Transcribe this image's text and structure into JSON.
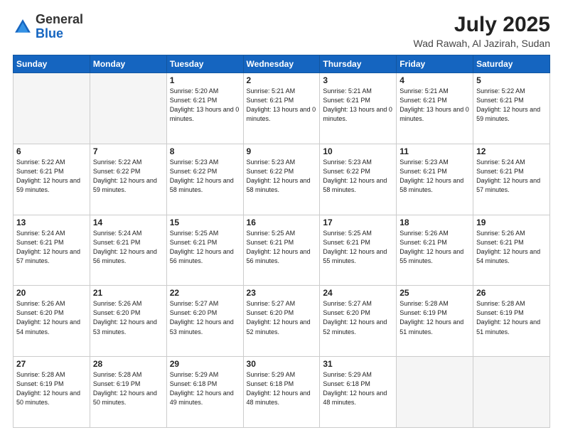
{
  "header": {
    "logo_line1": "General",
    "logo_line2": "Blue",
    "month_title": "July 2025",
    "location": "Wad Rawah, Al Jazirah, Sudan"
  },
  "weekdays": [
    "Sunday",
    "Monday",
    "Tuesday",
    "Wednesday",
    "Thursday",
    "Friday",
    "Saturday"
  ],
  "weeks": [
    [
      {
        "day": "",
        "info": ""
      },
      {
        "day": "",
        "info": ""
      },
      {
        "day": "1",
        "info": "Sunrise: 5:20 AM\nSunset: 6:21 PM\nDaylight: 13 hours and 0 minutes."
      },
      {
        "day": "2",
        "info": "Sunrise: 5:21 AM\nSunset: 6:21 PM\nDaylight: 13 hours and 0 minutes."
      },
      {
        "day": "3",
        "info": "Sunrise: 5:21 AM\nSunset: 6:21 PM\nDaylight: 13 hours and 0 minutes."
      },
      {
        "day": "4",
        "info": "Sunrise: 5:21 AM\nSunset: 6:21 PM\nDaylight: 13 hours and 0 minutes."
      },
      {
        "day": "5",
        "info": "Sunrise: 5:22 AM\nSunset: 6:21 PM\nDaylight: 12 hours and 59 minutes."
      }
    ],
    [
      {
        "day": "6",
        "info": "Sunrise: 5:22 AM\nSunset: 6:21 PM\nDaylight: 12 hours and 59 minutes."
      },
      {
        "day": "7",
        "info": "Sunrise: 5:22 AM\nSunset: 6:22 PM\nDaylight: 12 hours and 59 minutes."
      },
      {
        "day": "8",
        "info": "Sunrise: 5:23 AM\nSunset: 6:22 PM\nDaylight: 12 hours and 58 minutes."
      },
      {
        "day": "9",
        "info": "Sunrise: 5:23 AM\nSunset: 6:22 PM\nDaylight: 12 hours and 58 minutes."
      },
      {
        "day": "10",
        "info": "Sunrise: 5:23 AM\nSunset: 6:22 PM\nDaylight: 12 hours and 58 minutes."
      },
      {
        "day": "11",
        "info": "Sunrise: 5:23 AM\nSunset: 6:21 PM\nDaylight: 12 hours and 58 minutes."
      },
      {
        "day": "12",
        "info": "Sunrise: 5:24 AM\nSunset: 6:21 PM\nDaylight: 12 hours and 57 minutes."
      }
    ],
    [
      {
        "day": "13",
        "info": "Sunrise: 5:24 AM\nSunset: 6:21 PM\nDaylight: 12 hours and 57 minutes."
      },
      {
        "day": "14",
        "info": "Sunrise: 5:24 AM\nSunset: 6:21 PM\nDaylight: 12 hours and 56 minutes."
      },
      {
        "day": "15",
        "info": "Sunrise: 5:25 AM\nSunset: 6:21 PM\nDaylight: 12 hours and 56 minutes."
      },
      {
        "day": "16",
        "info": "Sunrise: 5:25 AM\nSunset: 6:21 PM\nDaylight: 12 hours and 56 minutes."
      },
      {
        "day": "17",
        "info": "Sunrise: 5:25 AM\nSunset: 6:21 PM\nDaylight: 12 hours and 55 minutes."
      },
      {
        "day": "18",
        "info": "Sunrise: 5:26 AM\nSunset: 6:21 PM\nDaylight: 12 hours and 55 minutes."
      },
      {
        "day": "19",
        "info": "Sunrise: 5:26 AM\nSunset: 6:21 PM\nDaylight: 12 hours and 54 minutes."
      }
    ],
    [
      {
        "day": "20",
        "info": "Sunrise: 5:26 AM\nSunset: 6:20 PM\nDaylight: 12 hours and 54 minutes."
      },
      {
        "day": "21",
        "info": "Sunrise: 5:26 AM\nSunset: 6:20 PM\nDaylight: 12 hours and 53 minutes."
      },
      {
        "day": "22",
        "info": "Sunrise: 5:27 AM\nSunset: 6:20 PM\nDaylight: 12 hours and 53 minutes."
      },
      {
        "day": "23",
        "info": "Sunrise: 5:27 AM\nSunset: 6:20 PM\nDaylight: 12 hours and 52 minutes."
      },
      {
        "day": "24",
        "info": "Sunrise: 5:27 AM\nSunset: 6:20 PM\nDaylight: 12 hours and 52 minutes."
      },
      {
        "day": "25",
        "info": "Sunrise: 5:28 AM\nSunset: 6:19 PM\nDaylight: 12 hours and 51 minutes."
      },
      {
        "day": "26",
        "info": "Sunrise: 5:28 AM\nSunset: 6:19 PM\nDaylight: 12 hours and 51 minutes."
      }
    ],
    [
      {
        "day": "27",
        "info": "Sunrise: 5:28 AM\nSunset: 6:19 PM\nDaylight: 12 hours and 50 minutes."
      },
      {
        "day": "28",
        "info": "Sunrise: 5:28 AM\nSunset: 6:19 PM\nDaylight: 12 hours and 50 minutes."
      },
      {
        "day": "29",
        "info": "Sunrise: 5:29 AM\nSunset: 6:18 PM\nDaylight: 12 hours and 49 minutes."
      },
      {
        "day": "30",
        "info": "Sunrise: 5:29 AM\nSunset: 6:18 PM\nDaylight: 12 hours and 48 minutes."
      },
      {
        "day": "31",
        "info": "Sunrise: 5:29 AM\nSunset: 6:18 PM\nDaylight: 12 hours and 48 minutes."
      },
      {
        "day": "",
        "info": ""
      },
      {
        "day": "",
        "info": ""
      }
    ]
  ]
}
